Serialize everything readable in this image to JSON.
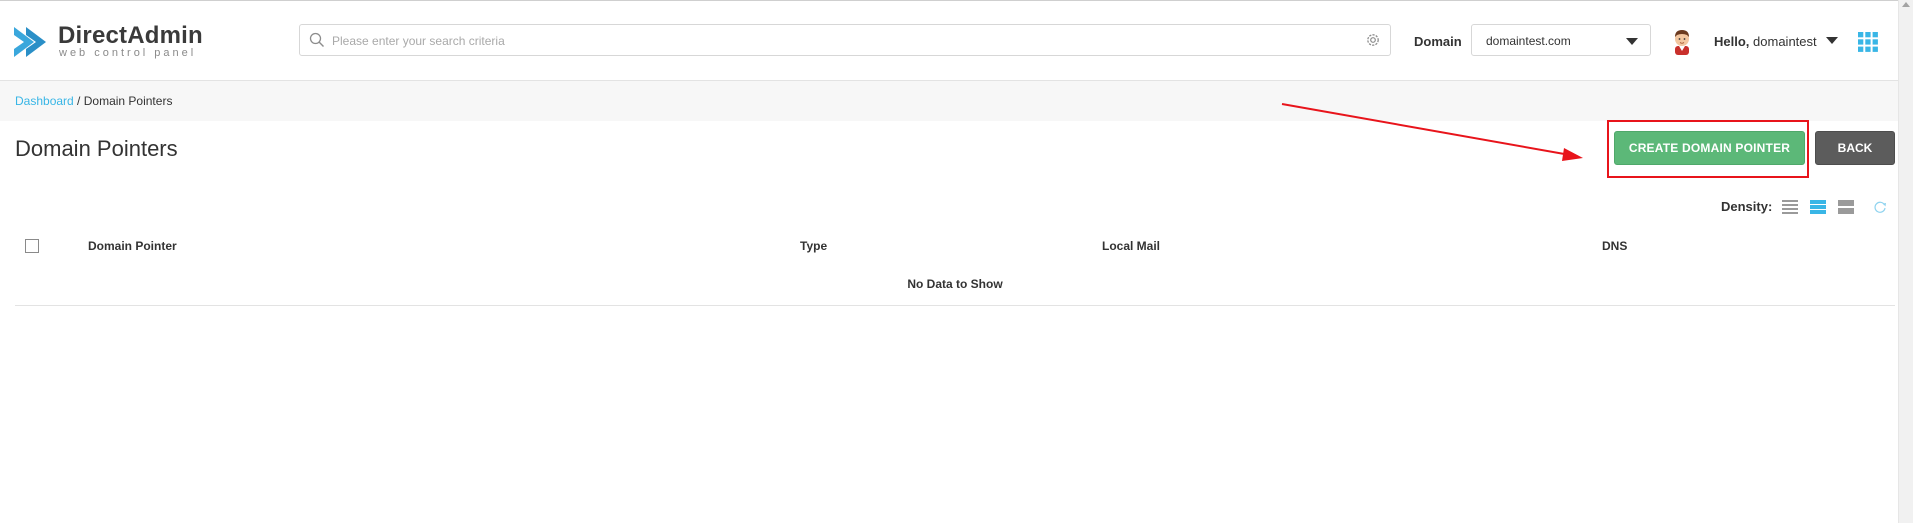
{
  "brand": {
    "name": "DirectAdmin",
    "tagline": "web control panel",
    "accent_color": "#39b6e6"
  },
  "search": {
    "value": "",
    "placeholder": "Please enter your search criteria",
    "icon": "search-icon",
    "settings_icon": "gear-icon"
  },
  "domain_selector": {
    "label": "Domain",
    "selected": "domaintest.com"
  },
  "user": {
    "greeting": "Hello,",
    "username": "domaintest"
  },
  "breadcrumb": {
    "root": "Dashboard",
    "separator": " / ",
    "current": "Domain Pointers"
  },
  "page": {
    "title": "Domain Pointers",
    "create_button": "CREATE DOMAIN POINTER",
    "back_button": "BACK",
    "create_button_color": "#5cb878",
    "back_button_color": "#5c5c5c",
    "annotation_color": "#e8141b"
  },
  "density": {
    "label": "Density:",
    "options": [
      "compact",
      "normal",
      "comfortable"
    ],
    "selected": "normal"
  },
  "table": {
    "columns": [
      "Domain Pointer",
      "Type",
      "Local Mail",
      "DNS"
    ],
    "empty_message": "No Data to Show"
  }
}
